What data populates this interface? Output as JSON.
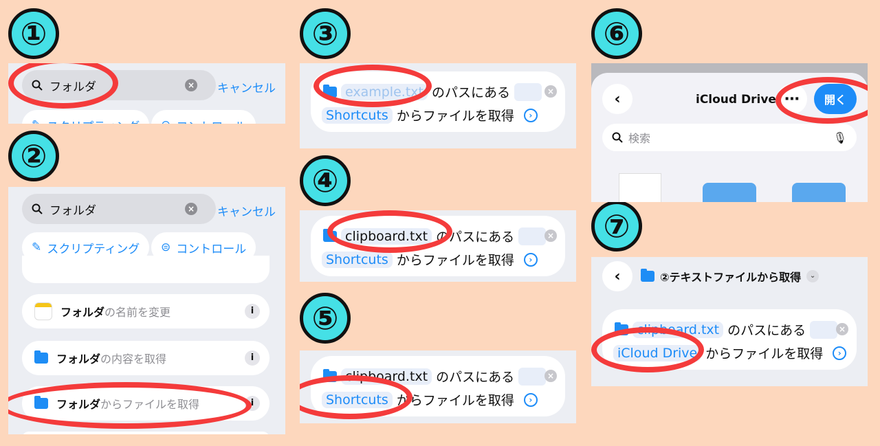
{
  "steps": [
    "①",
    "②",
    "③",
    "④",
    "⑤",
    "⑥",
    "⑦"
  ],
  "step1": {
    "search_value": "フォルダ",
    "cancel_label": "キャンセル",
    "chips": [
      "スクリプティング",
      "コントロール"
    ]
  },
  "step2": {
    "search_value": "フォルダ",
    "cancel_label": "キャンセル",
    "chips": [
      "スクリプティング",
      "コントロール"
    ],
    "items": [
      {
        "bold": "フォルダ",
        "rest": "の名前を変更"
      },
      {
        "bold": "フォルダ",
        "rest": "の内容を取得"
      },
      {
        "bold": "フォルダ",
        "rest": "からファイルを取得"
      }
    ],
    "info_label": "i"
  },
  "step3": {
    "path_placeholder": "example.txt",
    "path_suffix": "のパスにある",
    "location": "Shortcuts",
    "action_text": "からファイルを取得"
  },
  "step4": {
    "path_value": "clipboard.txt",
    "path_suffix": "のパスにある",
    "location": "Shortcuts",
    "action_text": "からファイルを取得"
  },
  "step5": {
    "path_value": "clipboard.txt",
    "path_suffix": "のパスにある",
    "location": "Shortcuts",
    "action_text": "からファイルを取得"
  },
  "step6": {
    "title": "iCloud Drive",
    "open_label": "開く",
    "search_placeholder": "検索"
  },
  "step7": {
    "shortcut_name": "②テキストファイルから取得",
    "path_value": "clipboard.txt",
    "path_suffix": "のパスにある",
    "location": "iCloud Drive",
    "action_text": "からファイルを取得"
  },
  "colors": {
    "accent": "#1d8cf8",
    "highlight_ring": "#f43b3b",
    "badge": "#45e0e6",
    "background": "#fdd7bd"
  }
}
